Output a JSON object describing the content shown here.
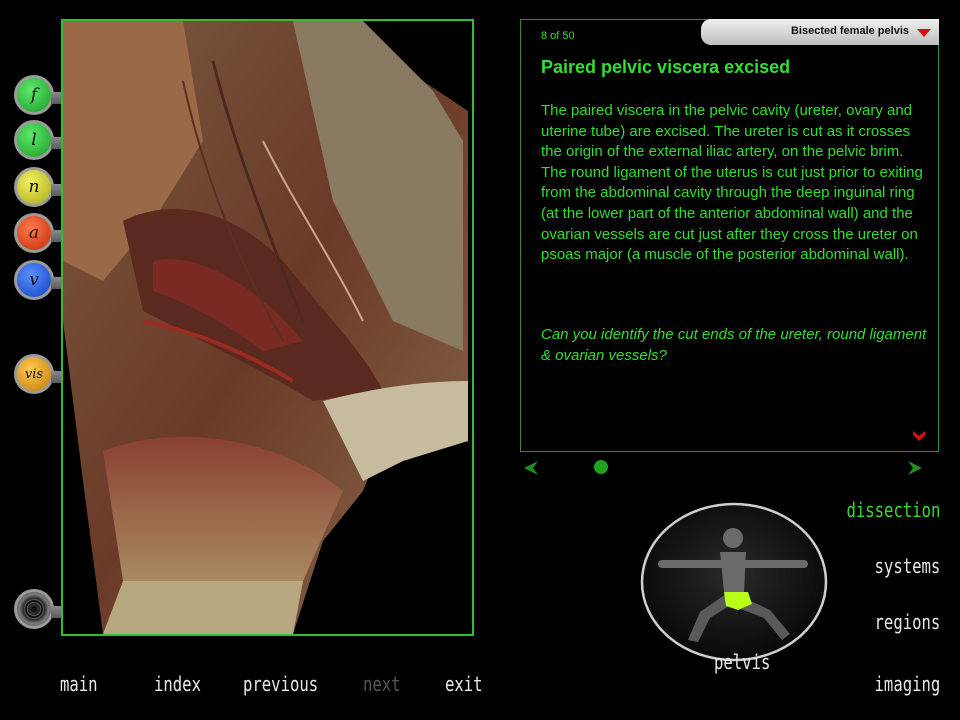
{
  "side_buttons": [
    {
      "label": "f",
      "color": "#2bc43a"
    },
    {
      "label": "l",
      "color": "#2bc43a"
    },
    {
      "label": "n",
      "color": "#c4c42b"
    },
    {
      "label": "a",
      "color": "#e0401a"
    },
    {
      "label": "v",
      "color": "#1f5fe0"
    },
    {
      "label": "vis",
      "color": "#e0a010"
    }
  ],
  "panel": {
    "counter": "8 of 50",
    "section": "Bisected female pelvis",
    "title": "Paired pelvic viscera excised",
    "body": "The paired viscera in the pelvic cavity (ureter, ovary and uterine tube) are excised. The ureter is cut as it crosses the origin of the external iliac artery, on the pelvic brim. The round ligament of the uterus is cut just prior to exiting from the abdominal cavity through the deep inguinal ring (at the lower part of the anterior abdominal wall) and the ovarian vessels are cut just after they cross the ureter on psoas major (a muscle of the posterior abdominal wall).",
    "question": "Can you identify the cut ends of the ureter, round ligament & ovarian vessels?"
  },
  "nav_right": {
    "dissection": "dissection",
    "systems": "systems",
    "regions": "regions",
    "imaging": "imaging"
  },
  "figure_label": "pelvis",
  "nav_bottom": {
    "main": "main",
    "index": "index",
    "previous": "previous",
    "next": "next",
    "exit": "exit"
  },
  "colors": {
    "accent_green": "#33dd33",
    "active_nav": "#33dd33",
    "inactive_nav": "#e8e8e8",
    "disabled_nav": "#555555",
    "alert_red": "#d61010"
  }
}
